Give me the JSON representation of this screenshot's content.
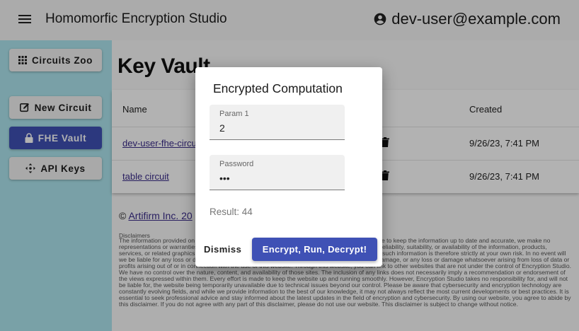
{
  "app": {
    "title": "Homomorfic Encryption Studio",
    "user_email": "dev-user@example.com",
    "user_icon": "account-circle-icon",
    "menu_icon": "hamburger-menu-icon"
  },
  "sidebar": {
    "items": [
      {
        "label": "Circuits Zoo",
        "icon": "grid-icon",
        "active": false
      },
      {
        "label": "New Circuit",
        "icon": "edit-icon",
        "active": false
      },
      {
        "label": "FHE Vault",
        "icon": "lock-icon",
        "active": true
      },
      {
        "label": "API Keys",
        "icon": "move-arrows-icon",
        "active": false
      }
    ]
  },
  "main": {
    "title": "Key Vault",
    "table": {
      "headers": {
        "name": "Name",
        "created": "Created"
      },
      "rows": [
        {
          "name": "dev-user-fhe-circu",
          "created": "9/26/23, 7:41 PM"
        },
        {
          "name": "table circuit",
          "created": "9/26/23, 7:41 PM"
        }
      ]
    },
    "footer": {
      "copyright_symbol": "©",
      "company_link": "Artifirm Inc. 20"
    },
    "disclaimer": {
      "title": "Disclaimers",
      "text": "The information provided on this website is for general informational purposes only. While we strive to keep the information up to date and accurate, we make no representations or warranties of any kind, express or implied, about the completeness, accuracy, reliability, suitability, or availability of the information, products, services, or related graphics contained on the website for any purpose. Any reliance you place on such information is therefore strictly at your own risk. In no event will we be liable for any loss or damage including without limitation, indirect or consequential loss or damage, or any loss or damage whatsoever arising from loss of data or profits arising out of or in connection with the use of this website. Through this website, you can link to other websites that are not under the control of Encryption Studio. We have no control over the nature, content, and availability of those sites. The inclusion of any links does not necessarily imply a recommendation or endorsement of the views expressed within them. Every effort is made to keep the website up and running smoothly. However, Encryption Studio takes no responsibility for, and will not be liable for, the website being temporarily unavailable due to technical issues beyond our control. Please be aware that cybersecurity and encryption technology are constantly evolving fields, and while we provide information to the best of our knowledge, it may not always reflect the most current developments or best practices. It is essential to seek professional advice and stay informed about the latest updates in the field of encryption and cybersecurity. By using our website, you agree to abide by this disclaimer. If you do not agree with any part of this disclaimer, please do not use our website. This disclaimer is subject to change without notice."
    }
  },
  "dialog": {
    "title": "Encrypted Computation",
    "fields": [
      {
        "label": "Param 1",
        "value": "2"
      },
      {
        "label": "Password",
        "value": "•••"
      }
    ],
    "result": "Result: 44",
    "dismiss_label": "Dismiss",
    "primary_label": "Encrypt, Run, Decrypt!"
  },
  "colors": {
    "primary": "#3f51b5",
    "sidebar_bg": "#aee6ef",
    "appbar_bg": "#f5f5f5",
    "link": "#3a2b8a"
  }
}
